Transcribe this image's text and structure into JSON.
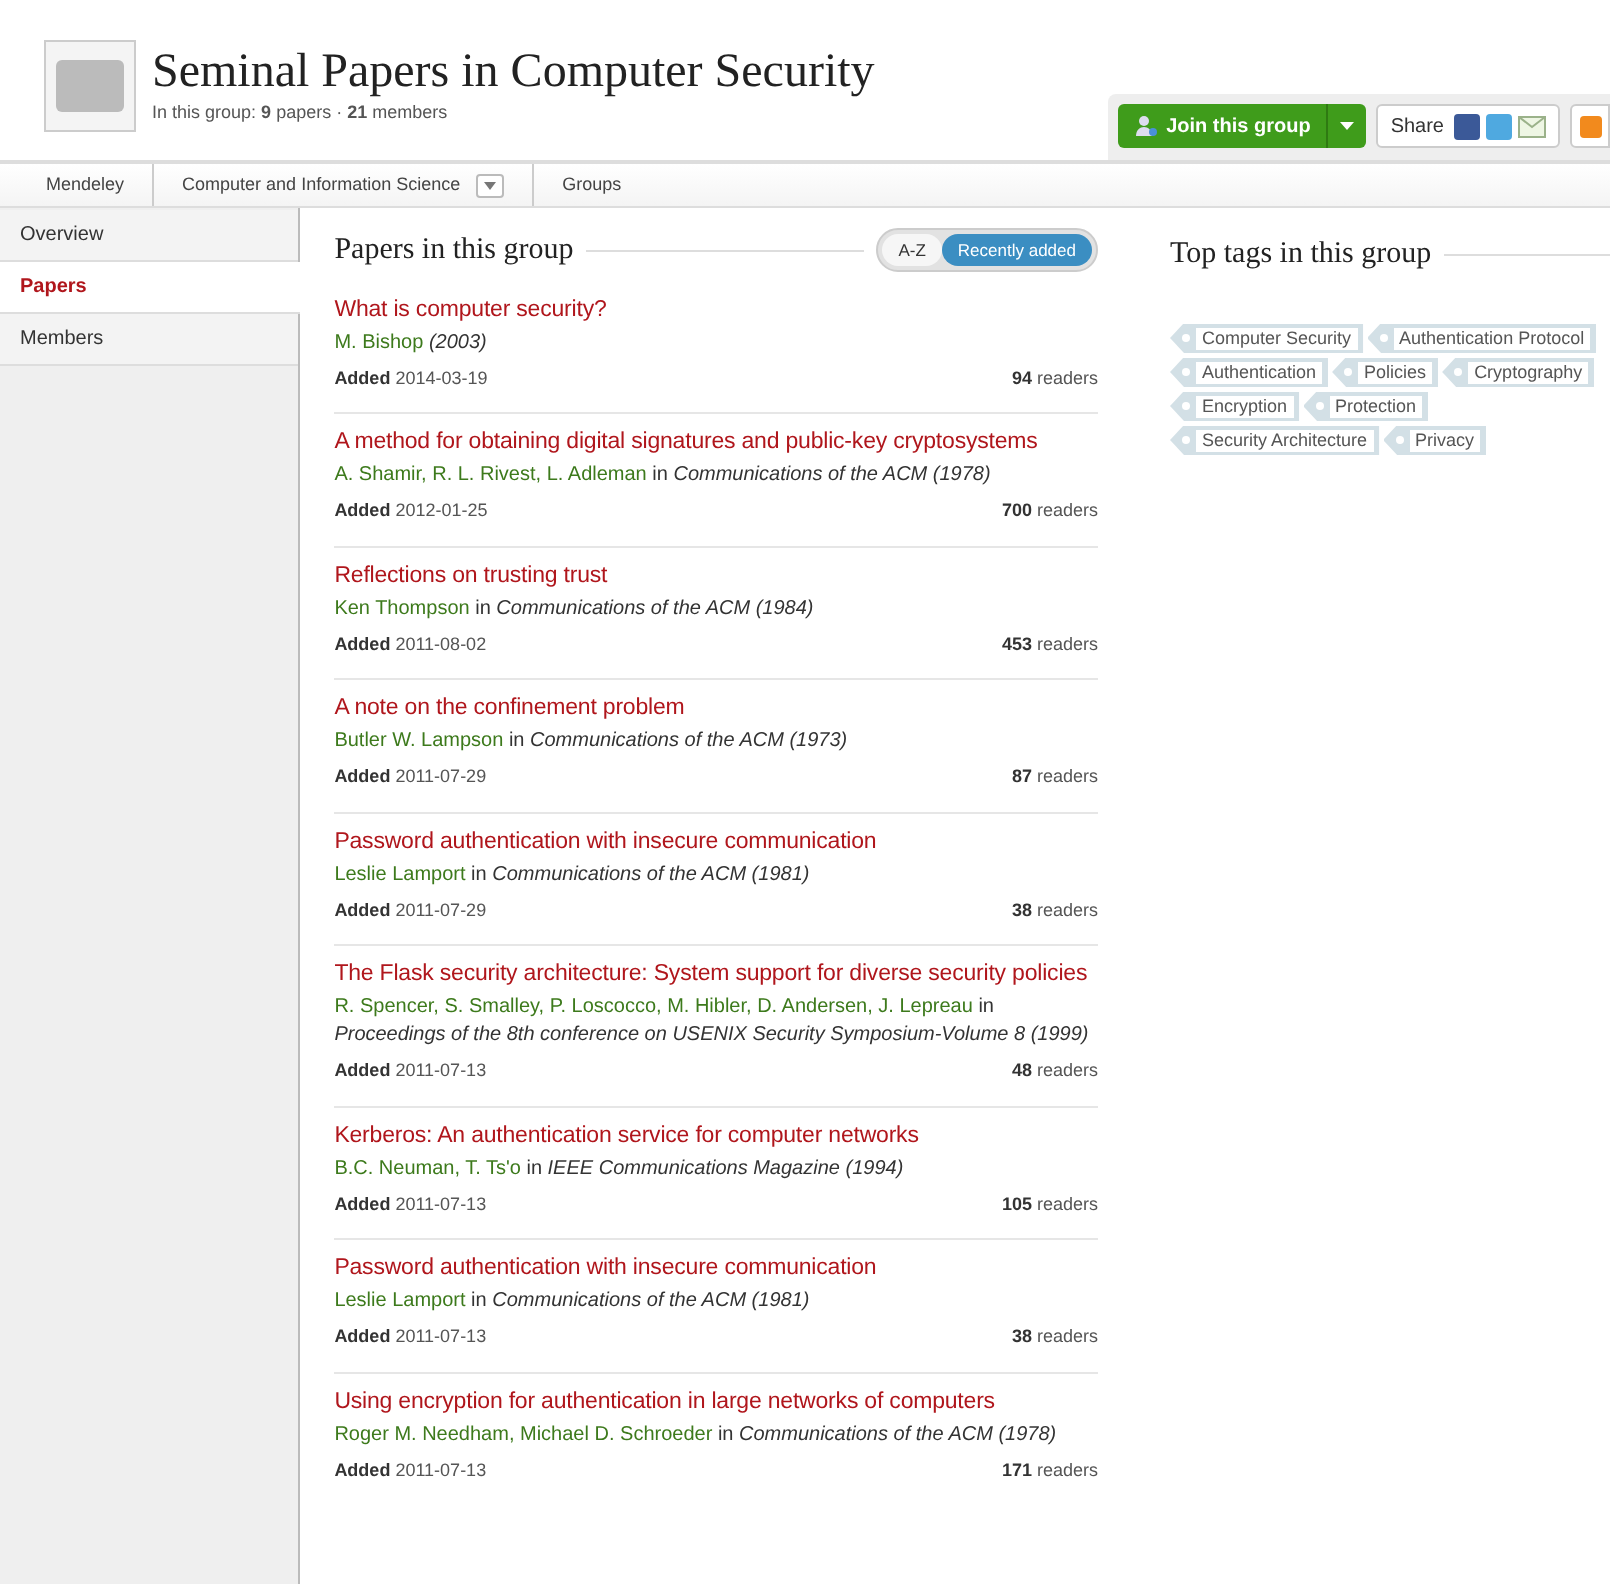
{
  "header": {
    "title": "Seminal Papers in Computer Security",
    "stats": "In this group: **9** papers · **21** members"
  },
  "actions": {
    "join": "Join this group",
    "share": "Share"
  },
  "breadcrumbs": [
    {
      "label": "Mendeley",
      "dropdown": false
    },
    {
      "label": "Computer and Information Science",
      "dropdown": true
    },
    {
      "label": "Groups",
      "dropdown": false
    }
  ],
  "sidebar": {
    "items": [
      {
        "label": "Overview",
        "selected": false
      },
      {
        "label": "Papers",
        "selected": true
      },
      {
        "label": "Members",
        "selected": false
      }
    ]
  },
  "papers": {
    "heading": "Papers in this group",
    "sort": [
      {
        "label": "A-Z",
        "selected": false
      },
      {
        "label": "Recently added",
        "selected": true
      }
    ],
    "items": [
      {
        "title": "What is computer security?",
        "authors": "M. Bishop",
        "venue": "(2003)",
        "added_label": "Added",
        "date": "2014-03-19",
        "readers": "94",
        "readers_label": "readers"
      },
      {
        "title": "A method for obtaining digital signatures and public-key cryptosystems",
        "authors": "A. Shamir, R. L. Rivest, L. Adleman",
        "connector": "in",
        "venue": "Communications of the ACM (1978)",
        "added_label": "Added",
        "date": "2012-01-25",
        "readers": "700",
        "readers_label": "readers"
      },
      {
        "title": "Reflections on trusting trust",
        "authors": "Ken Thompson",
        "connector": "in",
        "venue": "Communications of the ACM (1984)",
        "added_label": "Added",
        "date": "2011-08-02",
        "readers": "453",
        "readers_label": "readers"
      },
      {
        "title": "A note on the confinement problem",
        "authors": "Butler W. Lampson",
        "connector": "in",
        "venue": "Communications of the ACM (1973)",
        "added_label": "Added",
        "date": "2011-07-29",
        "readers": "87",
        "readers_label": "readers"
      },
      {
        "title": "Password authentication with insecure communication",
        "authors": "Leslie Lamport",
        "connector": "in",
        "venue": "Communications of the ACM (1981)",
        "added_label": "Added",
        "date": "2011-07-29",
        "readers": "38",
        "readers_label": "readers"
      },
      {
        "title": "The Flask security architecture: System support for diverse security policies",
        "authors": "R. Spencer, S. Smalley, P. Loscocco, M. Hibler, D. Andersen, J. Lepreau",
        "connector": "in",
        "venue": "Proceedings of the 8th conference on USENIX Security Symposium-Volume 8 (1999)",
        "added_label": "Added",
        "date": "2011-07-13",
        "readers": "48",
        "readers_label": "readers"
      },
      {
        "title": "Kerberos: An authentication service for computer networks",
        "authors": "B.C. Neuman, T. Ts'o",
        "connector": "in",
        "venue": "IEEE Communications Magazine (1994)",
        "added_label": "Added",
        "date": "2011-07-13",
        "readers": "105",
        "readers_label": "readers"
      },
      {
        "title": "Password authentication with insecure communication",
        "authors": "Leslie Lamport",
        "connector": "in",
        "venue": "Communications of the ACM (1981)",
        "added_label": "Added",
        "date": "2011-07-13",
        "readers": "38",
        "readers_label": "readers"
      },
      {
        "title": "Using encryption for authentication in large networks of computers",
        "authors": "Roger M. Needham, Michael D. Schroeder",
        "connector": "in",
        "venue": "Communications of the ACM (1978)",
        "added_label": "Added",
        "date": "2011-07-13",
        "readers": "171",
        "readers_label": "readers"
      }
    ]
  },
  "tags": {
    "heading": "Top tags in this group",
    "items": [
      "Computer Security",
      "Authentication Protocol",
      "Authentication",
      "Policies",
      "Cryptography",
      "Encryption",
      "Protection",
      "Security Architecture",
      "Privacy"
    ]
  }
}
